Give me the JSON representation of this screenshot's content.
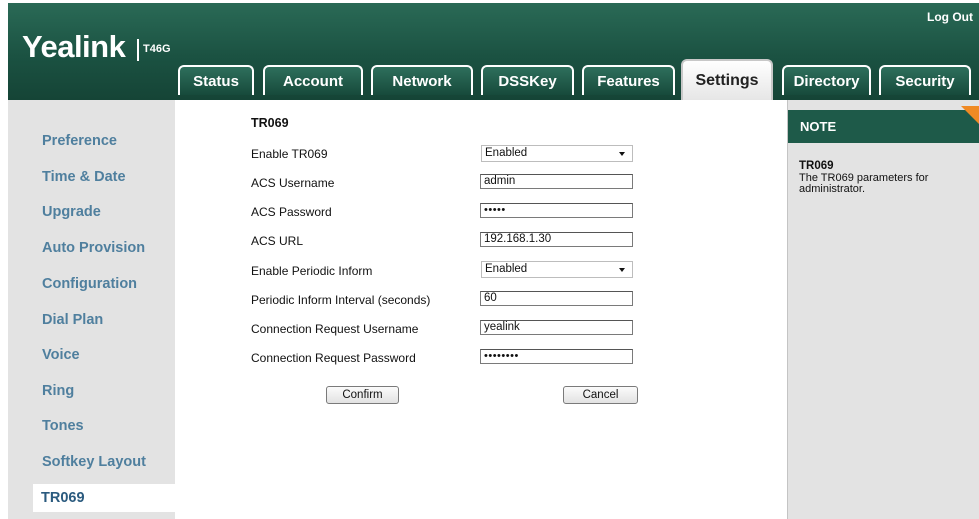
{
  "brand": {
    "logo": "Yealink",
    "model": "T46G"
  },
  "header": {
    "logout": "Log Out"
  },
  "tabs": [
    {
      "label": "Status"
    },
    {
      "label": "Account"
    },
    {
      "label": "Network"
    },
    {
      "label": "DSSKey"
    },
    {
      "label": "Features"
    },
    {
      "label": "Settings"
    },
    {
      "label": "Directory"
    },
    {
      "label": "Security"
    }
  ],
  "active_tab": "Settings",
  "sidebar": {
    "items": [
      {
        "label": "Preference"
      },
      {
        "label": "Time & Date"
      },
      {
        "label": "Upgrade"
      },
      {
        "label": "Auto Provision"
      },
      {
        "label": "Configuration"
      },
      {
        "label": "Dial Plan"
      },
      {
        "label": "Voice"
      },
      {
        "label": "Ring"
      },
      {
        "label": "Tones"
      },
      {
        "label": "Softkey Layout"
      },
      {
        "label": "TR069"
      }
    ],
    "active": "TR069"
  },
  "form": {
    "title": "TR069",
    "rows": [
      {
        "label": "Enable TR069",
        "type": "select",
        "value": "Enabled"
      },
      {
        "label": "ACS Username",
        "type": "text",
        "value": "admin"
      },
      {
        "label": "ACS Password",
        "type": "password",
        "value": "•••••"
      },
      {
        "label": "ACS URL",
        "type": "text",
        "value": "192.168.1.30"
      },
      {
        "label": "Enable Periodic Inform",
        "type": "select",
        "value": "Enabled"
      },
      {
        "label": "Periodic Inform Interval (seconds)",
        "type": "text",
        "value": "60"
      },
      {
        "label": "Connection Request Username",
        "type": "text",
        "value": "yealink"
      },
      {
        "label": "Connection Request Password",
        "type": "password",
        "value": "••••••••"
      }
    ],
    "confirm": "Confirm",
    "cancel": "Cancel"
  },
  "note": {
    "header": "NOTE",
    "title": "TR069",
    "text": "The TR069 parameters for administrator."
  },
  "colors": {
    "brand_green": "#1e5a49",
    "sidebar_bg": "#e3e3e3",
    "nav_link": "#4f7f9e",
    "note_corner": "#f08a24"
  }
}
